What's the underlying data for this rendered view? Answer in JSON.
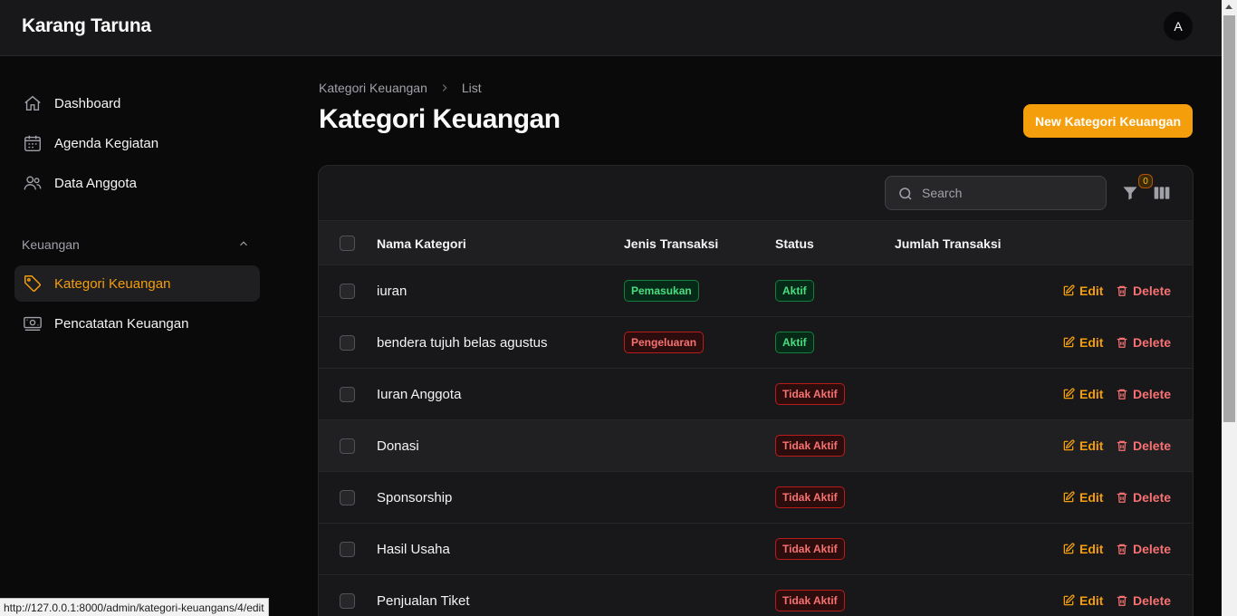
{
  "app": {
    "title": "Karang Taruna",
    "user_initial": "A"
  },
  "sidebar": {
    "items": [
      {
        "label": "Dashboard",
        "icon": "home-icon"
      },
      {
        "label": "Agenda Kegiatan",
        "icon": "calendar-icon"
      },
      {
        "label": "Data Anggota",
        "icon": "users-icon"
      }
    ],
    "group": {
      "label": "Keuangan",
      "items": [
        {
          "label": "Kategori Keuangan",
          "icon": "tag-icon",
          "active": true
        },
        {
          "label": "Pencatatan Keuangan",
          "icon": "cash-icon"
        }
      ]
    }
  },
  "breadcrumb": {
    "parent": "Kategori Keuangan",
    "current": "List"
  },
  "page": {
    "title": "Kategori Keuangan",
    "new_button": "New Kategori Keuangan"
  },
  "table": {
    "search_placeholder": "Search",
    "filter_count": "0",
    "columns": [
      "Nama Kategori",
      "Jenis Transaksi",
      "Status",
      "Jumlah Transaksi"
    ],
    "rows": [
      {
        "nama": "iuran",
        "jenis": "Pemasukan",
        "jenis_color": "green",
        "status": "Aktif",
        "status_color": "green"
      },
      {
        "nama": "bendera tujuh belas agustus",
        "jenis": "Pengeluaran",
        "jenis_color": "red",
        "status": "Aktif",
        "status_color": "green"
      },
      {
        "nama": "Iuran Anggota",
        "jenis": "",
        "status": "Tidak Aktif",
        "status_color": "red"
      },
      {
        "nama": "Donasi",
        "jenis": "",
        "status": "Tidak Aktif",
        "status_color": "red"
      },
      {
        "nama": "Sponsorship",
        "jenis": "",
        "status": "Tidak Aktif",
        "status_color": "red"
      },
      {
        "nama": "Hasil Usaha",
        "jenis": "",
        "status": "Tidak Aktif",
        "status_color": "red"
      },
      {
        "nama": "Penjualan Tiket",
        "jenis": "",
        "status": "Tidak Aktif",
        "status_color": "red"
      }
    ],
    "edit_label": "Edit",
    "delete_label": "Delete"
  },
  "status_bar": {
    "url": "http://127.0.0.1:8000/admin/kategori-keuangans/4/edit"
  },
  "colors": {
    "accent": "#f59e0b",
    "success": "#4ade80",
    "danger": "#f87171",
    "background": "#0a0a0b"
  }
}
